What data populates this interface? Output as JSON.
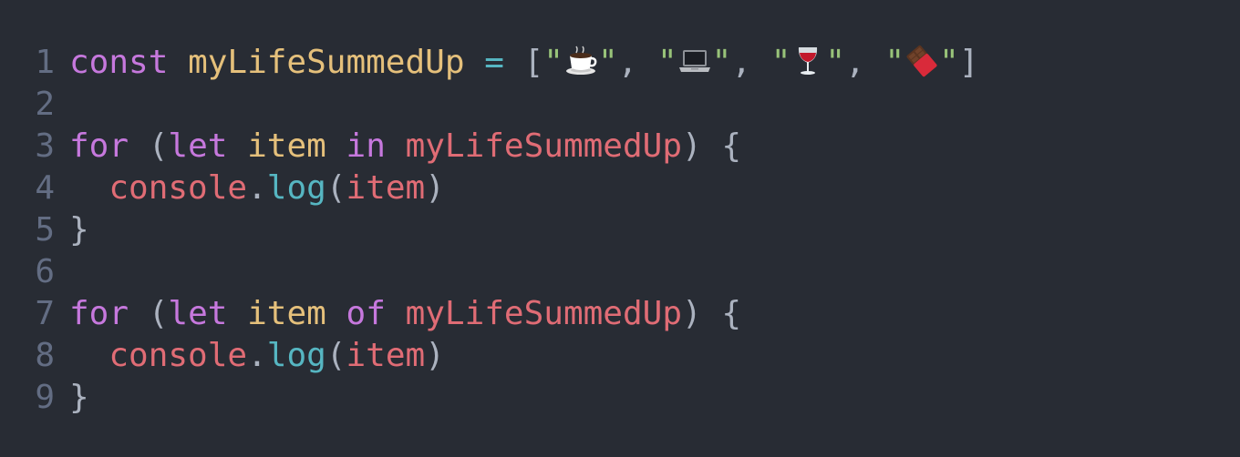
{
  "editor": {
    "lines": [
      {
        "number": "1"
      },
      {
        "number": "2"
      },
      {
        "number": "3"
      },
      {
        "number": "4"
      },
      {
        "number": "5"
      },
      {
        "number": "6"
      },
      {
        "number": "7"
      },
      {
        "number": "8"
      },
      {
        "number": "9"
      }
    ],
    "tokens": {
      "const": "const",
      "array_name": "myLifeSummedUp",
      "equals": "=",
      "open_bracket": "[",
      "close_bracket": "]",
      "quote": "\"",
      "comma": ", ",
      "for": "for",
      "let": "let",
      "item": "item",
      "in": "in",
      "of": "of",
      "open_paren": "(",
      "close_paren": ")",
      "open_brace": "{",
      "close_brace": "}",
      "console": "console",
      "dot": ".",
      "log": "log",
      "indent": "  ",
      "space": " "
    },
    "array_items": [
      "coffee-cup-icon",
      "laptop-icon",
      "wine-glass-icon",
      "chocolate-bar-icon"
    ],
    "colors": {
      "background": "#282c34",
      "line_number": "#636d83",
      "keyword": "#c678dd",
      "variable_declaration": "#e5c07b",
      "variable": "#e06c75",
      "operator": "#56b6c2",
      "string": "#98c379",
      "punctuation": "#abb2bf"
    }
  }
}
